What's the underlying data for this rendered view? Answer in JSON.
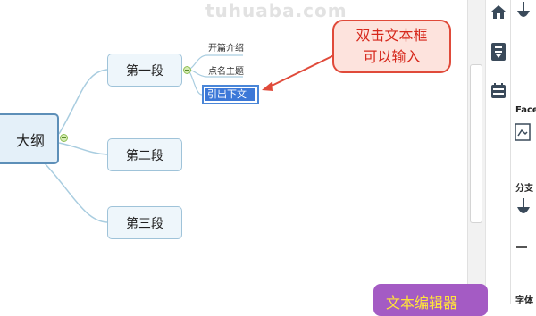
{
  "watermark": "tuhuaba.com",
  "mindmap": {
    "root_label": "大纲",
    "branches": [
      {
        "label": "第一段"
      },
      {
        "label": "第二段"
      },
      {
        "label": "第三段"
      }
    ],
    "subtopics": [
      "开篇介绍",
      "点名主题"
    ],
    "editing_text": "引出下文"
  },
  "callout": {
    "line1": "双击文本框",
    "line2": "可以输入"
  },
  "right_panel": {
    "labels": [
      "Face",
      "分支",
      "字体"
    ]
  },
  "bottom_badge": "文本编辑器",
  "colors": {
    "accent_red": "#e04a3a",
    "node_fill": "#eef6fb",
    "selection_blue": "#3c78d8",
    "badge_purple": "#a45bc4",
    "badge_text": "#ffe33a"
  },
  "icons": [
    "home-icon",
    "outline-icon",
    "calendar-icon",
    "face-icon",
    "branch-icon"
  ]
}
